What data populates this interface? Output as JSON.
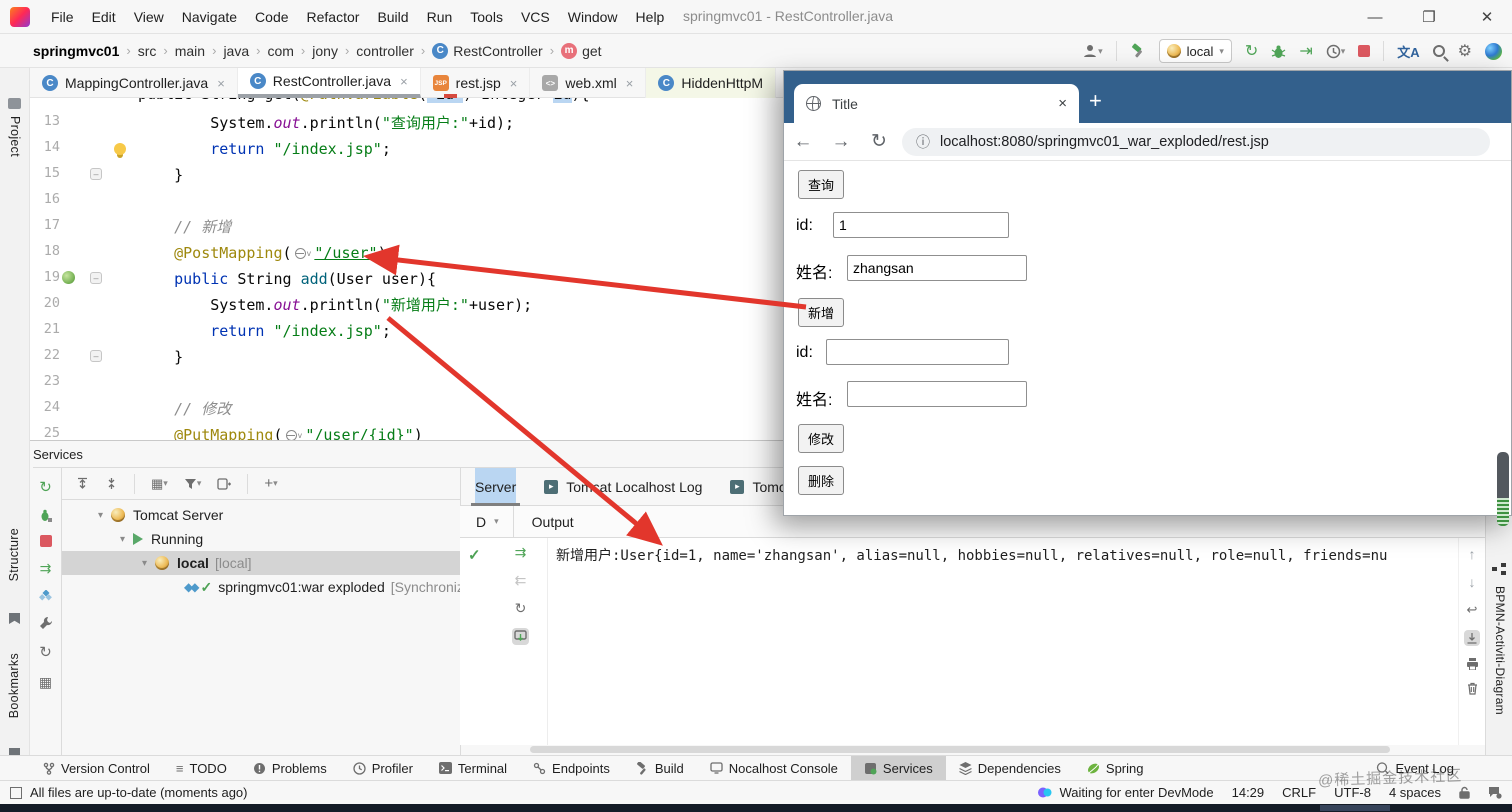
{
  "titlebar": {
    "menus": [
      "File",
      "Edit",
      "View",
      "Navigate",
      "Code",
      "Refactor",
      "Build",
      "Run",
      "Tools",
      "VCS",
      "Window",
      "Help"
    ],
    "title": "springmvc01 - RestController.java",
    "window_controls": {
      "minimize": "—",
      "maximize": "❐",
      "close": "✕"
    }
  },
  "navbar": {
    "crumbs": [
      "springmvc01",
      "src",
      "main",
      "java",
      "com",
      "jony",
      "controller",
      "RestController",
      "get"
    ],
    "run_config": "local"
  },
  "tabs": {
    "items": [
      {
        "label": "MappingController.java"
      },
      {
        "label": "RestController.java"
      },
      {
        "label": "rest.jsp"
      },
      {
        "label": "web.xml"
      },
      {
        "label": "HiddenHttpM"
      }
    ]
  },
  "left_stripe": {
    "project": "Project",
    "structure": "Structure",
    "bookmarks": "Bookmarks"
  },
  "editor": {
    "partial_line": [
      {
        "c": "p",
        "t": "public String get("
      },
      {
        "c": "a",
        "t": "@PathVariable"
      },
      {
        "c": "p",
        "t": "("
      },
      {
        "c": "sel",
        "t": "\"id\""
      },
      {
        "c": "p",
        "t": ") Integer "
      },
      {
        "c": "sel",
        "t": "id"
      },
      {
        "c": "p",
        "t": "){"
      }
    ],
    "lines": [
      {
        "num": "13",
        "tokens": [
          {
            "c": "p",
            "t": "        System."
          },
          {
            "c": "f",
            "t": "out"
          },
          {
            "c": "p",
            "t": ".println("
          },
          {
            "c": "s",
            "t": "\"查询用户:\""
          },
          {
            "c": "p",
            "t": "+id);"
          }
        ]
      },
      {
        "num": "14",
        "tokens": [
          {
            "c": "p",
            "t": "        "
          },
          {
            "c": "k",
            "t": "return"
          },
          {
            "c": "p",
            "t": " "
          },
          {
            "c": "s",
            "t": "\"/index.jsp\""
          },
          {
            "c": "p",
            "t": ";"
          }
        ]
      },
      {
        "num": "15",
        "tokens": [
          {
            "c": "p",
            "t": "    }"
          }
        ]
      },
      {
        "num": "16",
        "tokens": []
      },
      {
        "num": "17",
        "tokens": [
          {
            "c": "p",
            "t": "    "
          },
          {
            "c": "c",
            "t": "// 新增"
          }
        ]
      },
      {
        "num": "18",
        "tokens": [
          {
            "c": "p",
            "t": "    "
          },
          {
            "c": "a",
            "t": "@PostMapping"
          },
          {
            "c": "p",
            "t": "("
          },
          {
            "c": "i",
            "t": ""
          },
          {
            "c": "u",
            "t": "\"/user\""
          },
          {
            "c": "p",
            "t": ")"
          }
        ]
      },
      {
        "num": "19",
        "tokens": [
          {
            "c": "p",
            "t": "    "
          },
          {
            "c": "k",
            "t": "public"
          },
          {
            "c": "p",
            "t": " String "
          },
          {
            "c": "m",
            "t": "add"
          },
          {
            "c": "p",
            "t": "(User user){"
          }
        ]
      },
      {
        "num": "20",
        "tokens": [
          {
            "c": "p",
            "t": "        System."
          },
          {
            "c": "f",
            "t": "out"
          },
          {
            "c": "p",
            "t": ".println("
          },
          {
            "c": "s",
            "t": "\"新增用户:\""
          },
          {
            "c": "p",
            "t": "+user);"
          }
        ]
      },
      {
        "num": "21",
        "tokens": [
          {
            "c": "p",
            "t": "        "
          },
          {
            "c": "k",
            "t": "return"
          },
          {
            "c": "p",
            "t": " "
          },
          {
            "c": "s",
            "t": "\"/index.jsp\""
          },
          {
            "c": "p",
            "t": ";"
          }
        ]
      },
      {
        "num": "22",
        "tokens": [
          {
            "c": "p",
            "t": "    }"
          }
        ]
      },
      {
        "num": "23",
        "tokens": []
      },
      {
        "num": "24",
        "tokens": [
          {
            "c": "p",
            "t": "    "
          },
          {
            "c": "c",
            "t": "// 修改"
          }
        ]
      },
      {
        "num": "25",
        "tokens": [
          {
            "c": "p",
            "t": "    "
          },
          {
            "c": "a",
            "t": "@PutMapping"
          },
          {
            "c": "p",
            "t": "("
          },
          {
            "c": "i",
            "t": ""
          },
          {
            "c": "u",
            "t": "\"/user/{id}\""
          },
          {
            "c": "p",
            "t": ")"
          }
        ]
      }
    ]
  },
  "browser": {
    "tab_title": "Title",
    "new_tab": "+",
    "close_tab": "×",
    "url": "localhost:8080/springmvc01_war_exploded/rest.jsp",
    "nav": {
      "back": "←",
      "forward": "→",
      "reload": "↻",
      "info": "ⓘ"
    },
    "form": {
      "query_button": "查询",
      "add_button": "新增",
      "modify_button": "修改",
      "delete_button": "删除",
      "fields": [
        {
          "label": "id:",
          "value": "1"
        },
        {
          "label": "姓名:",
          "value": "zhangsan"
        },
        {
          "label": "id:",
          "value": ""
        },
        {
          "label": "姓名:",
          "value": ""
        }
      ]
    }
  },
  "services": {
    "title": "Services",
    "tree": [
      {
        "label": "Tomcat Server",
        "suffix": ""
      },
      {
        "label": "Running",
        "suffix": ""
      },
      {
        "label": "local",
        "suffix": "[local]"
      },
      {
        "label": "springmvc01:war exploded",
        "suffix": "[Synchroniz"
      }
    ],
    "console": {
      "tabs": [
        "Server",
        "Tomcat Localhost Log",
        "Tomca"
      ],
      "col_dropdown": "D",
      "col_output": "Output",
      "status_check": "✓",
      "output_line": "新增用户:User{id=1, name='zhangsan', alias=null, hobbies=null, relatives=null, role=null, friends=nu"
    },
    "right_stripe": "BPMN-Activiti-Diagram"
  },
  "bottombar": {
    "items": [
      "Version Control",
      "TODO",
      "Problems",
      "Profiler",
      "Terminal",
      "Endpoints",
      "Build",
      "Nocalhost Console",
      "Services",
      "Dependencies",
      "Spring"
    ],
    "right_item": "Event Log"
  },
  "statusbar": {
    "left": "All files are up-to-date (moments ago)",
    "devmode": "Waiting for enter DevMode",
    "time": "14:29",
    "line_ending": "CRLF",
    "encoding": "UTF-8",
    "indent": "4 spaces"
  },
  "watermark": "@稀土掘金技术社区",
  "colors": {
    "annotation_red": "#E2362C",
    "browser_chrome": "#33608C",
    "accent_green": "#4FA457"
  }
}
